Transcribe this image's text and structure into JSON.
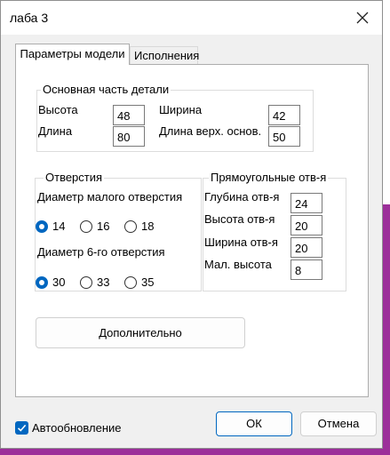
{
  "window": {
    "title": "лаба 3"
  },
  "tabs": [
    {
      "label": "Параметры модели",
      "active": true
    },
    {
      "label": "Исполнения",
      "active": false
    }
  ],
  "main_group": {
    "title": "Основная часть детали",
    "height_label": "Высота",
    "height_value": "48",
    "width_label": "Ширина",
    "width_value": "42",
    "length_label": "Длина",
    "length_value": "80",
    "top_length_label": "Длина верх. основ.",
    "top_length_value": "50"
  },
  "holes_group": {
    "title": "Отверстия",
    "small_diameter_label": "Диаметр малого отверстия",
    "small_options": [
      "14",
      "16",
      "18"
    ],
    "small_selected": "14",
    "six_diameter_label": "Диаметр 6-го отверстия",
    "six_options": [
      "30",
      "33",
      "35"
    ],
    "six_selected": "30"
  },
  "rect_holes_group": {
    "title": "Прямоугольные отв-я",
    "depth_label": "Глубина отв-я",
    "depth_value": "24",
    "height_label": "Высота отв-я",
    "height_value": "20",
    "width_label": "Ширина отв-я",
    "width_value": "20",
    "small_height_label": "Мал. высота",
    "small_height_value": "8"
  },
  "extra_button": "Дополнительно",
  "footer": {
    "auto_update_label": "Автообновление",
    "auto_update_checked": true,
    "ok_label": "ОК",
    "cancel_label": "Отмена"
  },
  "colors": {
    "accent": "#0067c0",
    "dialog_bg": "#f0f0f0",
    "background_app": "#9c2f9a"
  }
}
